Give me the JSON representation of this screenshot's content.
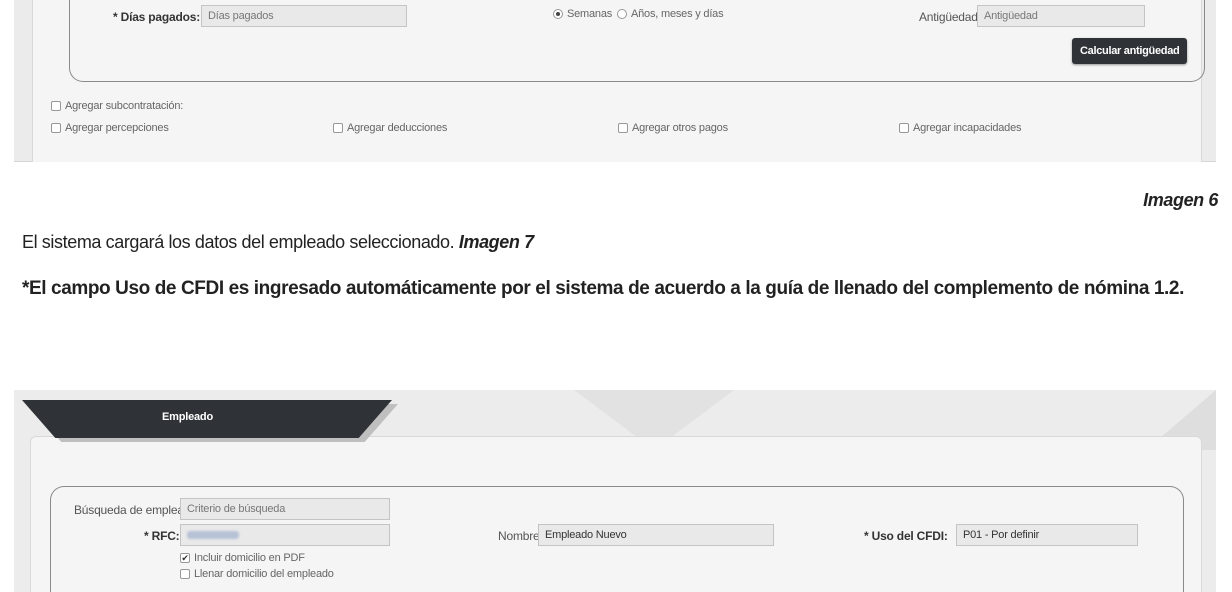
{
  "top_form": {
    "dias_pagados_label": "* Días pagados:",
    "dias_pagados_placeholder": "Días pagados",
    "radio_semanas": "Semanas",
    "radio_anios": "Años, meses y días",
    "antiguedad_label": "Antigüedad:",
    "antiguedad_placeholder": "Antigüedad",
    "calcular_button": "Calcular antigüedad",
    "subcontratacion": "Agregar subcontratación:",
    "percepciones": "Agregar percepciones",
    "deducciones": "Agregar deducciones",
    "otros_pagos": "Agregar otros pagos",
    "incapacidades": "Agregar incapacidades"
  },
  "document": {
    "caption6": "Imagen 6",
    "para_text": "El sistema cargará los datos del empleado seleccionado. ",
    "para_ref": "Imagen 7",
    "note": "*El campo Uso de CFDI es ingresado automáticamente por el sistema de acuerdo a la guía de llenado del complemento de nómina 1.2."
  },
  "bottom_form": {
    "tab_title": "Empleado",
    "busqueda_label": "Búsqueda de empleado:",
    "busqueda_placeholder": "Criterio de búsqueda",
    "rfc_label": "* RFC:",
    "nombre_label": "Nombre:",
    "nombre_value": "Empleado Nuevo",
    "uso_cfdi_label": "* Uso del CFDI:",
    "uso_cfdi_value": "P01 - Por definir",
    "incluir_domicilio": "Incluir domicilio en PDF",
    "llenar_domicilio": "Llenar domicilio del empleado"
  }
}
